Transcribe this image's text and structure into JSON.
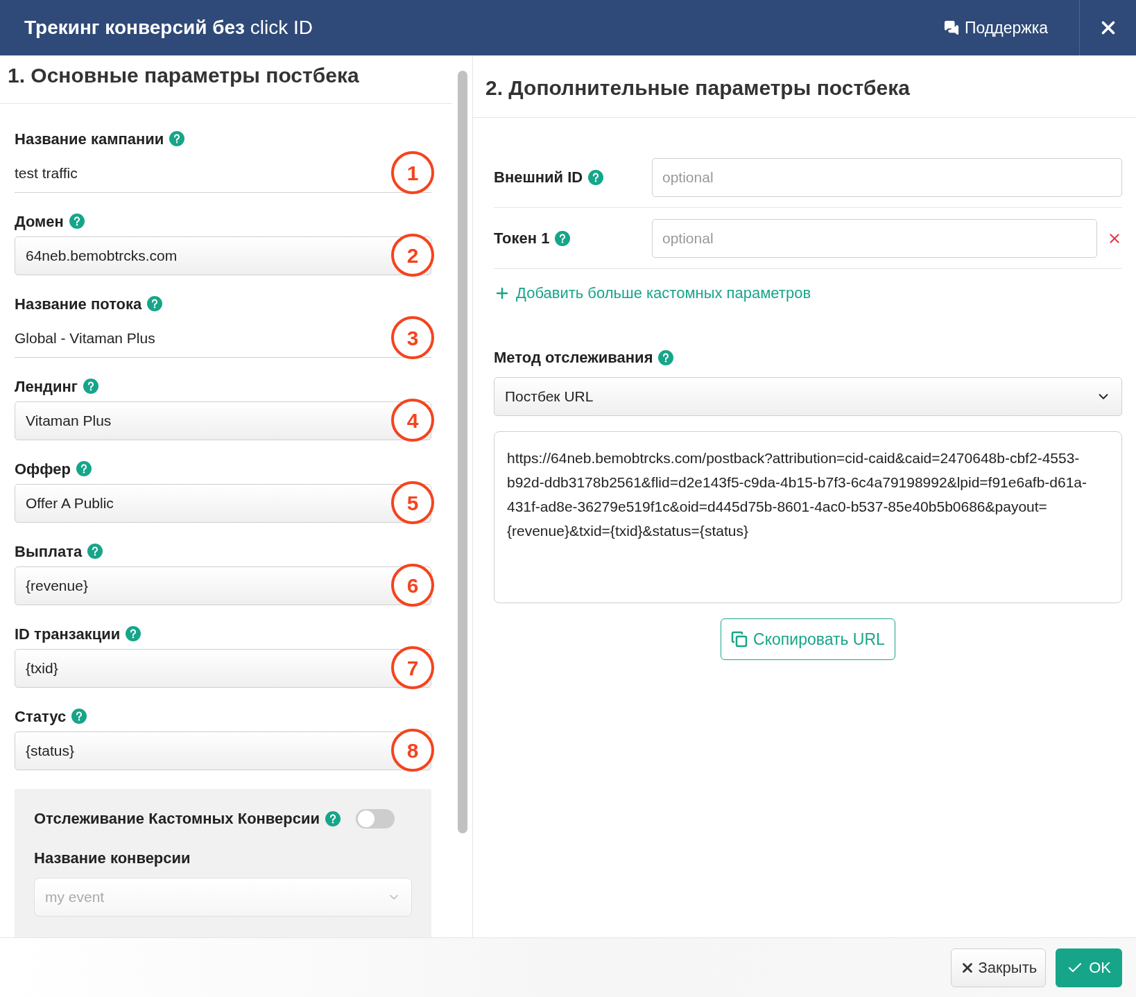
{
  "header": {
    "title": "**Трекинг конверсий без** click ID",
    "support": "Поддержка"
  },
  "left": {
    "heading": "1. Основные параметры постбека",
    "fields": [
      {
        "label": "Название кампании",
        "value": "test traffic",
        "kind": "plain",
        "badge": "1"
      },
      {
        "label": "Домен",
        "value": "64neb.bemobtrcks.com",
        "kind": "input",
        "badge": "2"
      },
      {
        "label": "Название потока",
        "value": "Global - Vitaman Plus",
        "kind": "plain",
        "badge": "3"
      },
      {
        "label": "Лендинг",
        "value": "Vitaman Plus",
        "kind": "input",
        "badge": "4"
      },
      {
        "label": "Оффер",
        "value": "Offer A Public",
        "kind": "input",
        "badge": "5"
      },
      {
        "label": "Выплата",
        "value": "{revenue}",
        "kind": "input",
        "badge": "6"
      },
      {
        "label": "ID транзакции",
        "value": "{txid}",
        "kind": "input",
        "badge": "7"
      },
      {
        "label": "Статус",
        "value": "{status}",
        "kind": "input",
        "badge": "8"
      }
    ],
    "custom": {
      "label": "Отслеживание Кастомных Конверсии",
      "on": false,
      "name_label": "Название конверсии",
      "placeholder": "my event"
    }
  },
  "right": {
    "heading": "2. Дополнительные параметры постбека",
    "params": [
      {
        "label": "Внешний ID",
        "placeholder": "optional",
        "removable": false
      },
      {
        "label": "Токен 1",
        "placeholder": "optional",
        "removable": true
      }
    ],
    "add_link": "Добавить больше кастомных параметров",
    "method_label": "Метод отслеживания",
    "method": "Постбек URL",
    "url": "https://64neb.bemobtrcks.com/postback?attribution=cid-caid&caid=2470648b-cbf2-4553-b92d-ddb3178b2561&flid=d2e143f5-c9da-4b15-b7f3-6c4a79198992&lpid=f91e6afb-d61a-431f-ad8e-36279e519f1c&oid=d445d75b-8601-4ac0-b537-85e40b5b0686&payout={revenue}&txid={txid}&status={status}",
    "copy": "Скопировать URL"
  },
  "footer": {
    "close": "Закрыть",
    "ok": "OK"
  }
}
